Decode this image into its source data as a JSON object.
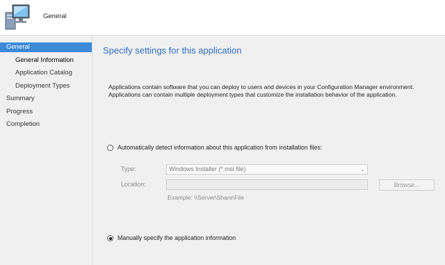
{
  "header": {
    "title": "General",
    "icon": "computer-monitor-icon"
  },
  "sidebar": {
    "items": [
      {
        "label": "General"
      },
      {
        "label": "General Information"
      },
      {
        "label": "Application Catalog"
      },
      {
        "label": "Deployment Types"
      },
      {
        "label": "Summary"
      },
      {
        "label": "Progress"
      },
      {
        "label": "Completion"
      }
    ]
  },
  "main": {
    "title": "Specify settings for this application",
    "intro_line1": "Applications contain software that you can deploy to users and devices in your Configuration Manager environment.",
    "intro_line2": "Applications can contain multiple deployment types that customize the installation behavior of the application.",
    "auto_detect": {
      "label": "Automatically detect information about this application from installation files:",
      "checked": false,
      "type_label": "Type:",
      "type_value": "Windows Installer (*.msi file)",
      "location_label": "Location:",
      "location_value": "",
      "browse_label": "Browse...",
      "example": "Example: \\\\Server\\Share\\File"
    },
    "manual": {
      "label": "Manually specify the application information",
      "checked": true
    }
  },
  "colors": {
    "accent": "#3c8ad8",
    "title": "#2f6dbb"
  }
}
